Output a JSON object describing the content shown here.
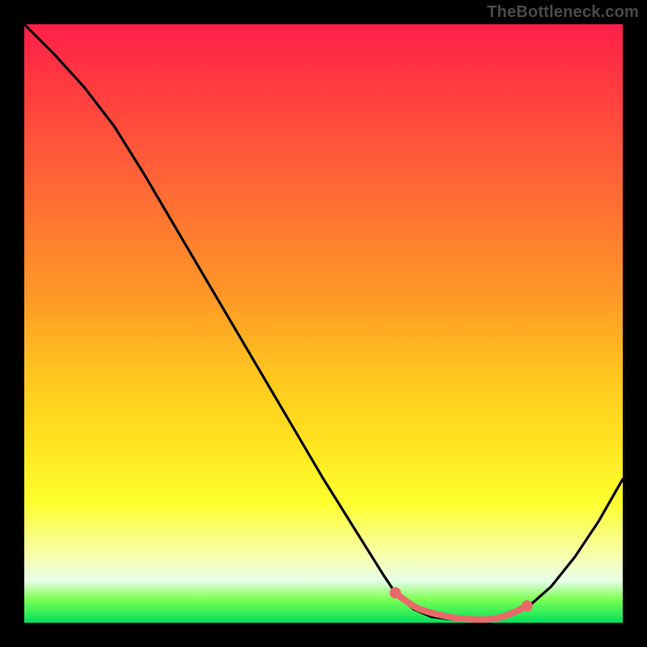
{
  "watermark": "TheBottleneck.com",
  "colors": {
    "page_bg": "#000000",
    "watermark_text": "#4a4a4a",
    "curve": "#000000",
    "highlight": "#e86a6a"
  },
  "chart_data": {
    "type": "line",
    "title": "",
    "xlabel": "",
    "ylabel": "",
    "xlim": [
      0,
      100
    ],
    "ylim": [
      0,
      100
    ],
    "grid": false,
    "series": [
      {
        "name": "curve",
        "x": [
          0,
          5,
          10,
          15,
          20,
          25,
          30,
          35,
          40,
          45,
          50,
          55,
          60,
          62,
          65,
          68,
          72,
          76,
          80,
          84,
          88,
          92,
          96,
          100
        ],
        "values": [
          100,
          95,
          89.5,
          83,
          75,
          66.5,
          58,
          49.5,
          41,
          32.5,
          24,
          16,
          8,
          5,
          2.3,
          1,
          0.5,
          0.5,
          1,
          2.5,
          6,
          11,
          17,
          24
        ]
      }
    ],
    "highlight_region": {
      "x": [
        62,
        63,
        64,
        65,
        66,
        67.5,
        69,
        70.5,
        72,
        74,
        76,
        78,
        80,
        82,
        83,
        84
      ],
      "values": [
        5.0,
        4.2,
        3.5,
        2.8,
        2.3,
        1.8,
        1.4,
        1.1,
        0.8,
        0.6,
        0.5,
        0.6,
        1.0,
        1.8,
        2.3,
        2.8
      ]
    }
  }
}
